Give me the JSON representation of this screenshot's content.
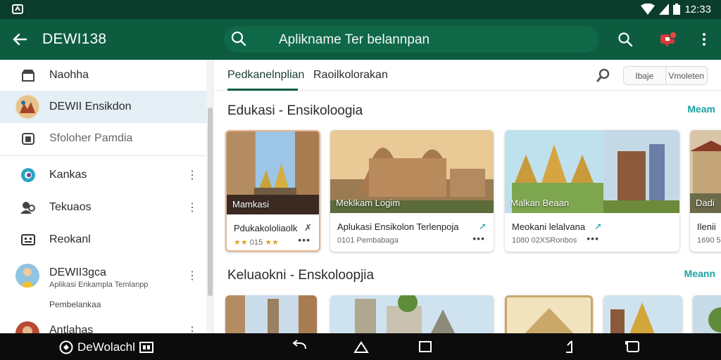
{
  "status_bar": {
    "time": "12:33"
  },
  "app_bar": {
    "title": "DEWI138",
    "search_text": "Aplikname Ter  belannpan"
  },
  "sidebar": {
    "items": [
      {
        "label": "Naohha",
        "icon": "store-icon"
      },
      {
        "label": "DEWII Ensikdon",
        "icon": "avatar-icon",
        "active": true
      },
      {
        "label": "Sfoloher Pamdia",
        "icon": "camera-icon"
      },
      {
        "label": "Kankas",
        "icon": "globe-icon"
      },
      {
        "label": "Tekuaos",
        "icon": "people-icon"
      },
      {
        "label": "Reokanl",
        "icon": "keyboard-icon"
      },
      {
        "label": "DEWII3gca",
        "sublabel": "Aplikasi Enkampla Temlanpp",
        "icon": "avatar-icon"
      },
      {
        "label": "Pembelankaa"
      },
      {
        "label": "Antlahas",
        "icon": "avatar-icon"
      }
    ]
  },
  "tabs": [
    {
      "label": "Pedkanelnplian",
      "active": true
    },
    {
      "label": "Raoilkolorakan"
    }
  ],
  "segmented": {
    "left": "Ibaje",
    "right": "Vmoleten"
  },
  "sections": [
    {
      "title": "Edukasi - Ensikoloogia",
      "more": "Meam",
      "cards": [
        {
          "overlay": "Mamkasi",
          "title": "Pdukakololiaolk",
          "meta": "015",
          "rating": "★★",
          "rating2": "★★"
        },
        {
          "overlay": "Meklkam Logim",
          "title": "Aplukasi Ensikolon Terlenpoja",
          "meta": "0101 Pembabaga"
        },
        {
          "overlay": "Malkan Beaan",
          "title": "Meokani lelalvana",
          "meta": "1080 02XSRonbos"
        },
        {
          "overlay": "",
          "title": "",
          "meta": ""
        },
        {
          "overlay": "Dadi",
          "title": "Ilenii",
          "meta": "1690 5"
        }
      ]
    },
    {
      "title": "Keluaokni - Enskoloopjia",
      "more": "Meann"
    }
  ],
  "nav_bar": {
    "brand": "DeWolachl"
  }
}
